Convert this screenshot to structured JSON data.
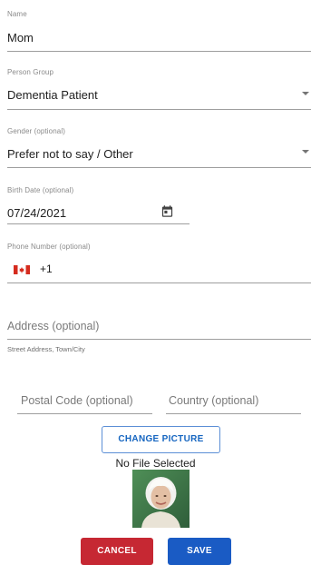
{
  "name": {
    "label": "Name",
    "value": "Mom"
  },
  "person_group": {
    "label": "Person Group",
    "value": "Dementia Patient"
  },
  "gender": {
    "label": "Gender (optional)",
    "value": "Prefer not to say / Other"
  },
  "birth_date": {
    "label": "Birth Date (optional)",
    "value": "07/24/2021",
    "icon": "calendar-icon"
  },
  "phone": {
    "label": "Phone Number (optional)",
    "country_code": "+1",
    "flag_icon": "canada-flag-icon",
    "value": ""
  },
  "address": {
    "placeholder": "Address (optional)",
    "helper": "Street Address, Town/City"
  },
  "postal_code": {
    "placeholder": "Postal Code (optional)"
  },
  "country": {
    "placeholder": "Country (optional)"
  },
  "picture": {
    "change_label": "CHANGE PICTURE",
    "status": "No File Selected"
  },
  "actions": {
    "cancel_label": "CANCEL",
    "save_label": "SAVE"
  },
  "colors": {
    "accent": "#1565c0",
    "cancel": "#c62833",
    "save": "#1a5bc4"
  }
}
